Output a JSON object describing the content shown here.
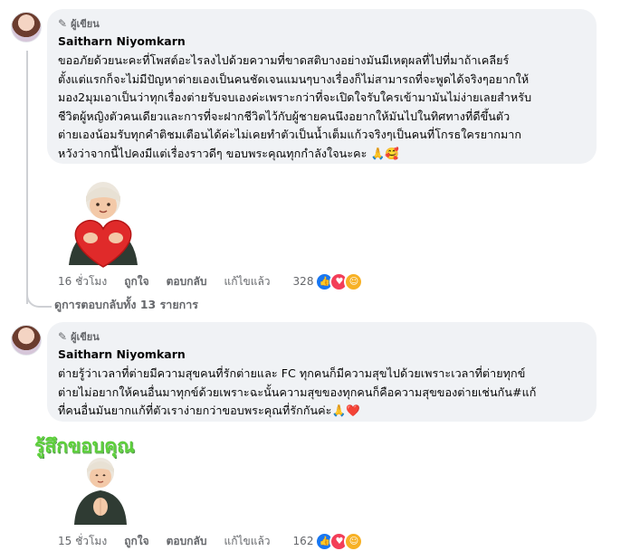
{
  "comments": [
    {
      "badge": "ผู้เขียน",
      "author": "Saitharn Niyomkarn",
      "lines": [
        "ขออภัยด้วยนะคะที่โพสต์อะไรลงไปด้วยความที่ขาดสติบางอย่างมันมีเหตุผลที่ไปที่มาถ้าเคลียร์",
        "ตั้งแต่แรกก็จะไม่มีปัญหาต่ายเองเป็นคนชัดเจนแมนๆบางเรื่องก็ไม่สามารถที่จะพูดได้จริงๆอยากให้",
        "มอง2มุมเอาเป็นว่าทุกเรื่องต่ายรับจบเองค่ะเพราะกว่าที่จะเปิดใจรับใครเข้ามามันไม่ง่ายเลยสำหรับ",
        "ชีวิตผู้หญิงตัวคนเดียวและการที่จะฝากชีวิตไว้กับผู้ชายคนนึงอยากให้มันไปในทิศทางที่ดีขึ้นตัว",
        "ต่ายเองน้อมรับทุกคำติชมเตือนได้ค่ะไม่เคยทำตัวเป็นน้ำเต็มแก้วจริงๆเป็นคนที่โกรธใครยากมาก",
        "หวังว่าจากนี้ไปคงมีแต่เรื่องราวดีๆ ขอบพระคุณทุกกำลังใจนะคะ 🙏🥰"
      ],
      "sticker_icon": "heart-hug-sticker",
      "time": "16 ชั่วโมง",
      "like": "ถูกใจ",
      "reply": "ตอบกลับ",
      "edited": "แก้ไขแล้ว",
      "reaction_count": "328"
    },
    {
      "badge": "ผู้เขียน",
      "author": "Saitharn Niyomkarn",
      "lines": [
        "ต่ายรู้ว่าเวลาที่ต่ายมีความสุขคนที่รักต่ายและ FC ทุกคนก็มีความสุขไปด้วยเพราะเวลาที่ต่ายทุกข์",
        "ต่ายไม่อยากให้คนอื่นมาทุกข์ด้วยเพราะฉะนั้นความสุขของทุกคนก็คือความสุขของต่ายเช่นกัน#แก้",
        "ที่คนอื่นมันยากแก้ที่ตัวเราง่ายกว่าขอบพระคุณที่รักกันค่ะ🙏❤️"
      ],
      "sticker_title": "รู้สึกขอบคุณ",
      "sticker_icon": "thankful-sticker",
      "time": "15 ชั่วโมง",
      "like": "ถูกใจ",
      "reply": "ตอบกลับ",
      "edited": "แก้ไขแล้ว",
      "reaction_count": "162"
    }
  ],
  "view_replies": "ดูการตอบกลับทั้ง 13 รายการ",
  "reactions": [
    "like-icon",
    "love-icon",
    "care-icon"
  ],
  "colors": {
    "bubble": "#f0f2f5",
    "meta": "#65676b",
    "like": "#1877f2",
    "love": "#f33e58",
    "care": "#f7b125",
    "sticker_title": "#5ccf3a"
  }
}
